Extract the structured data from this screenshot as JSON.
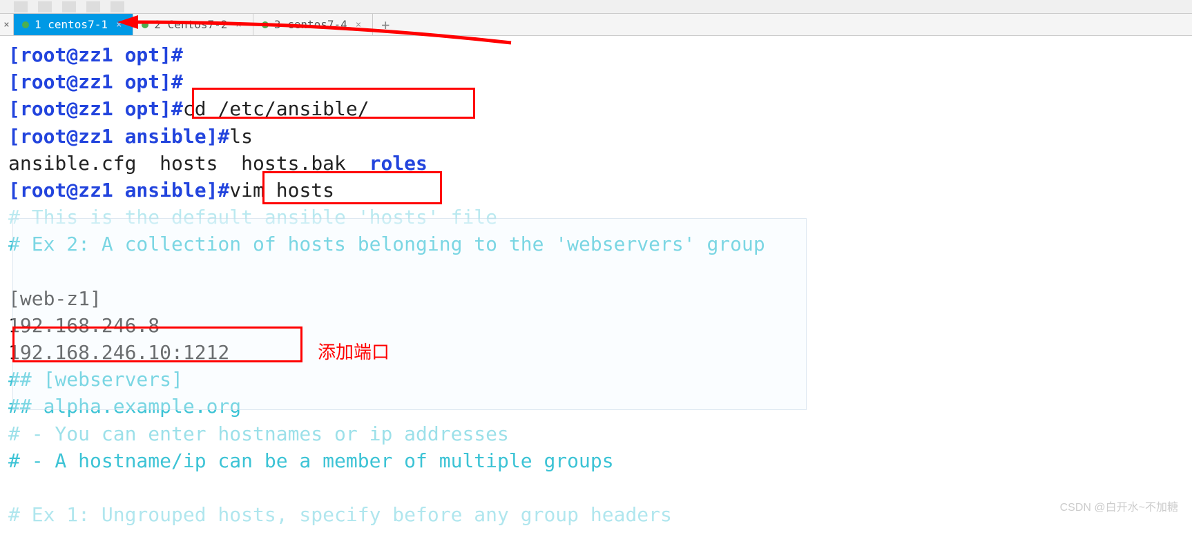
{
  "toolbar": {
    "present": true
  },
  "tabs": [
    {
      "label": "1 centos7-1",
      "active": true
    },
    {
      "label": "2 Centos7-2",
      "active": false
    },
    {
      "label": "3 centos7-4",
      "active": false
    }
  ],
  "terminal": {
    "lines": [
      {
        "prompt": "[root@zz1 opt]#",
        "cmd": ""
      },
      {
        "prompt": "[root@zz1 opt]#",
        "cmd": ""
      },
      {
        "prompt": "[root@zz1 opt]#",
        "cmd": "cd /etc/ansible/"
      },
      {
        "prompt": "[root@zz1 ansible]#",
        "cmd": "ls"
      },
      {
        "output_files": [
          "ansible.cfg",
          "hosts",
          "hosts.bak"
        ],
        "output_dir": "roles"
      },
      {
        "prompt": "[root@zz1 ansible]#",
        "cmd": "vim hosts"
      },
      {
        "comment_partial": "# This is the default ansible 'hosts' file"
      },
      {
        "comment": "# Ex 2: A collection of hosts belonging to the 'webservers' group"
      },
      {
        "blank": true
      },
      {
        "plain": " [web-z1]"
      },
      {
        "plain": "192.168.246.8"
      },
      {
        "plain": "192.168.246.10:1212"
      },
      {
        "comment": "## [webservers]"
      },
      {
        "comment": "## alpha.example.org"
      },
      {
        "comment_partial2": "#   - You can enter hostnames or ip addresses"
      },
      {
        "comment": "#   - A hostname/ip can be a member of multiple groups"
      },
      {
        "blank": true
      },
      {
        "comment_partial3": "# Ex 1: Ungrouped hosts, specify before any group headers"
      }
    ]
  },
  "annotations": {
    "port_label": "添加端口",
    "watermark": "CSDN @白开水~不加糖"
  }
}
